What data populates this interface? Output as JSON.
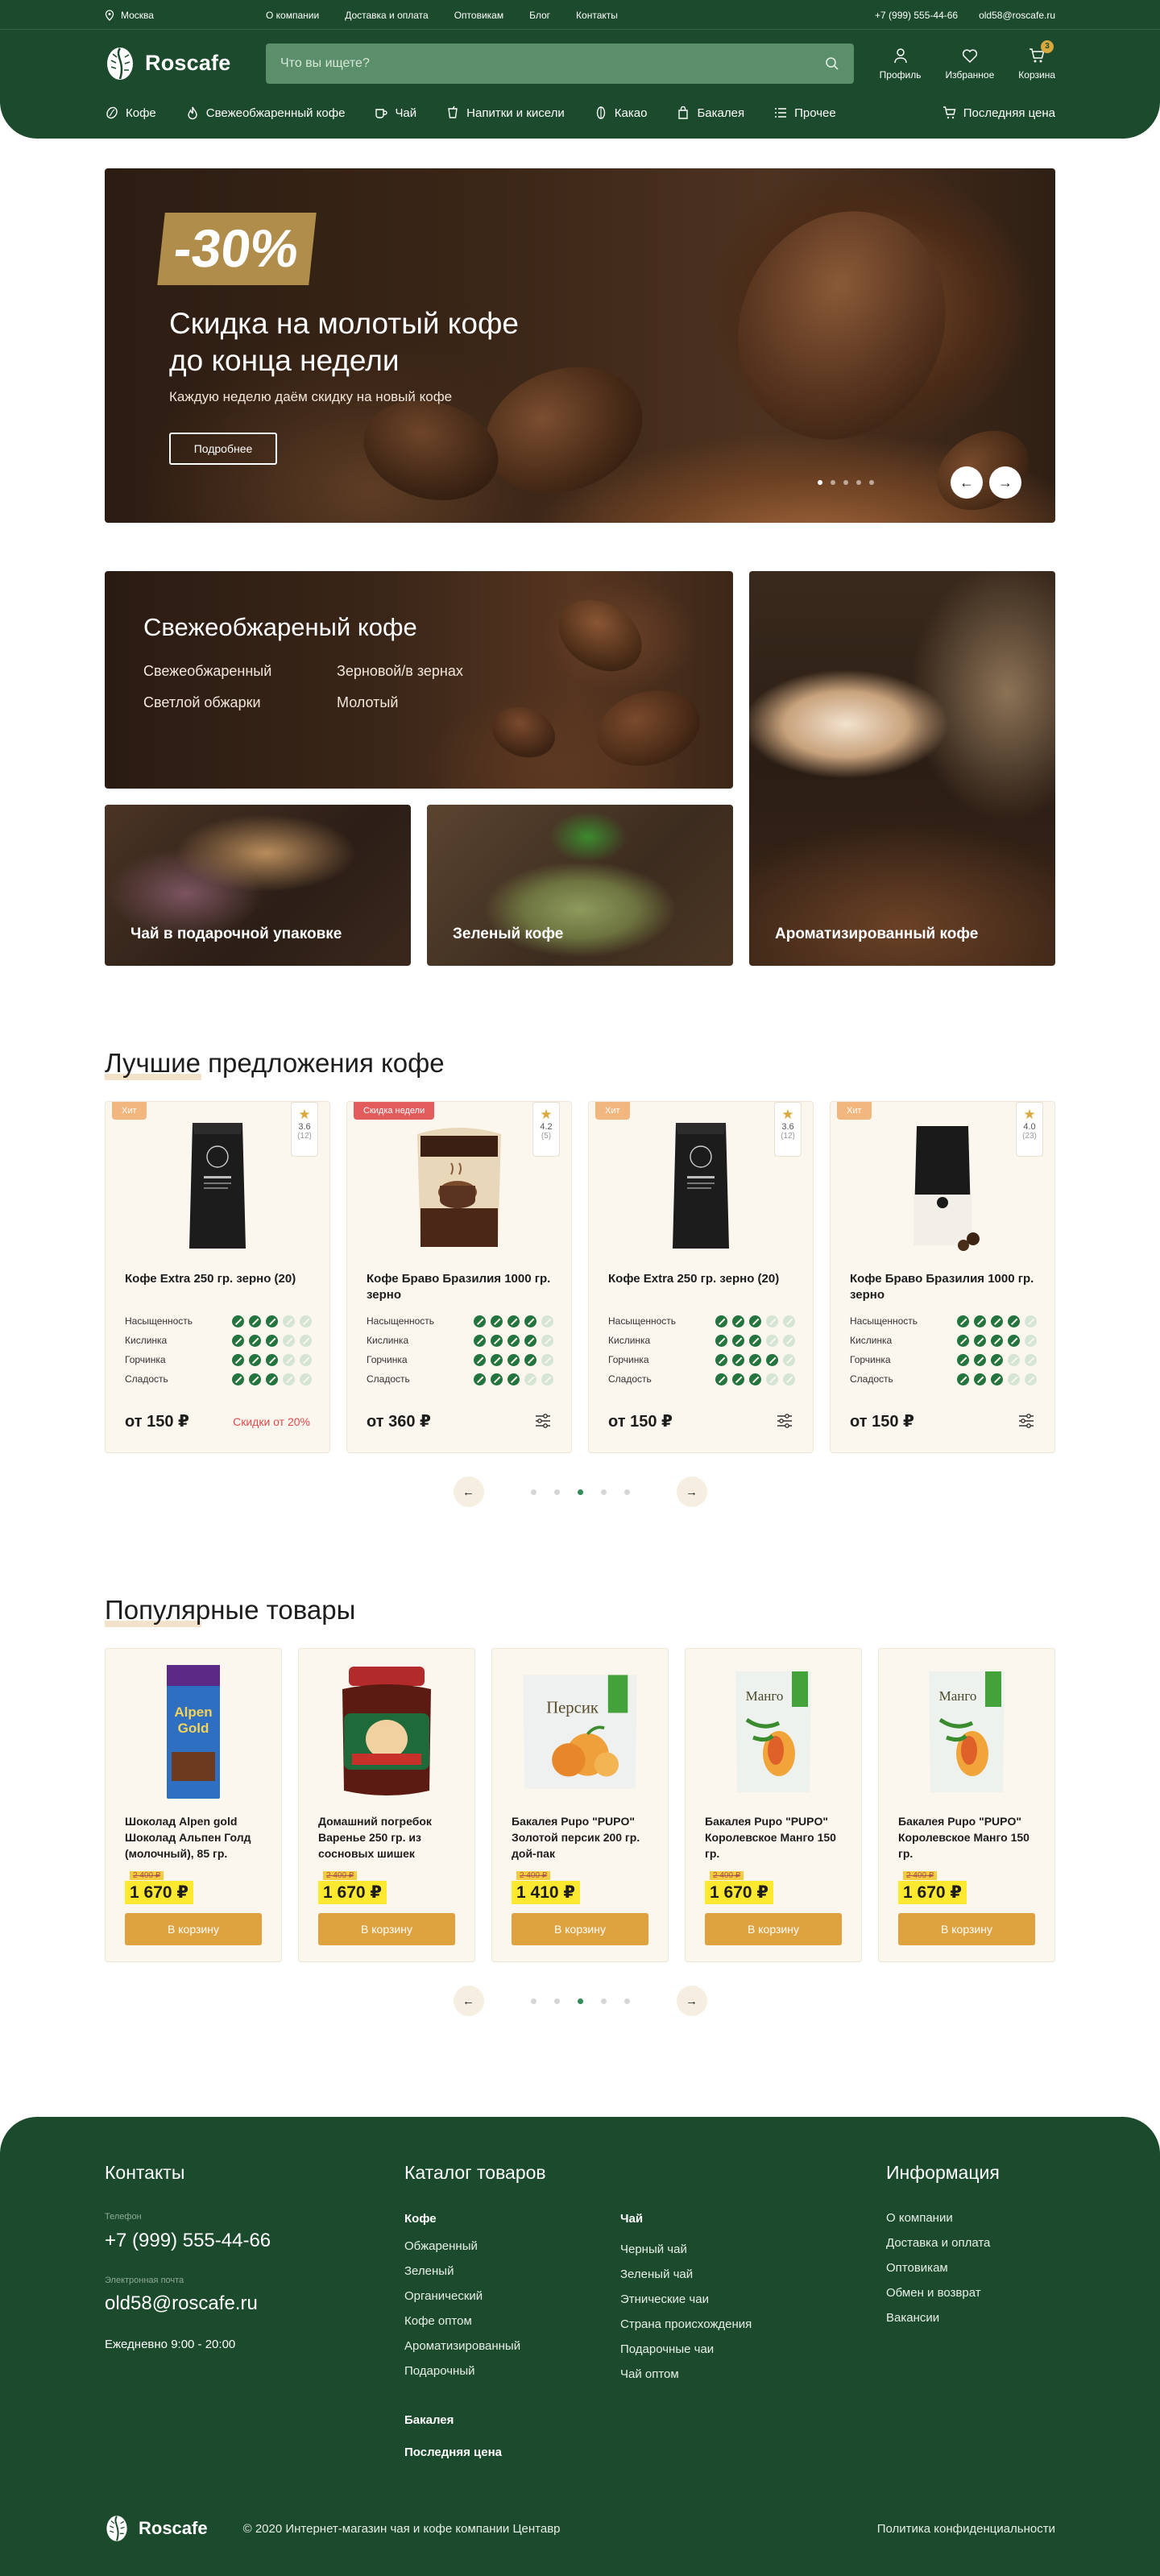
{
  "topbar": {
    "city": "Москва",
    "links": [
      "О компании",
      "Доставка и оплата",
      "Оптовикам",
      "Блог",
      "Контакты"
    ],
    "phone": "+7 (999) 555-44-66",
    "email": "old58@roscafe.ru"
  },
  "header": {
    "brand": "Roscafe",
    "search_placeholder": "Что вы ищете?",
    "profile_label": "Профиль",
    "favorites_label": "Избранное",
    "cart_label": "Корзина",
    "cart_count": "3"
  },
  "catnav": [
    {
      "label": "Кофе",
      "icon": "coffee-bean-icon"
    },
    {
      "label": "Свежеобжаренный кофе",
      "icon": "fire-icon"
    },
    {
      "label": "Чай",
      "icon": "tea-cup-icon"
    },
    {
      "label": "Напитки и кисели",
      "icon": "drink-icon"
    },
    {
      "label": "Какао",
      "icon": "cocoa-icon"
    },
    {
      "label": "Бакалея",
      "icon": "grocery-bag-icon"
    },
    {
      "label": "Прочее",
      "icon": "list-icon"
    }
  ],
  "catnav_last": "Последняя цена",
  "hero": {
    "badge": "-30%",
    "title": "Скидка на молотый кофе до конца недели",
    "subtitle": "Каждую неделю даём скидку на новый кофе",
    "button": "Подробнее",
    "slides": 5,
    "active_slide": 1
  },
  "categories": {
    "main": {
      "title": "Свежеобжареный кофе",
      "links": [
        "Свежеобжаренный",
        "Зерновой/в зернах",
        "Светлой обжарки",
        "Молотый"
      ]
    },
    "tiles": [
      "Ароматизированный кофе",
      "Чай в подарочной упаковке",
      "Зеленый кофе"
    ]
  },
  "best": {
    "title": "Лучшие предложения кофе",
    "prop_names": [
      "Насыщенность",
      "Кислинка",
      "Горчинка",
      "Сладость"
    ],
    "items": [
      {
        "tag": "Хит",
        "tag_type": "hit",
        "rating": "3.6",
        "reviews": "(12)",
        "name": "Кофе Extra 250 гр. зерно (20)",
        "levels": [
          3,
          3,
          3,
          3
        ],
        "price": "от 150 ₽",
        "note": "Скидки от 20%",
        "pack": "black"
      },
      {
        "tag": "Скидка недели",
        "tag_type": "week",
        "rating": "4.2",
        "reviews": "(5)",
        "name": "Кофе Браво Бразилия 1000 гр. зерно",
        "levels": [
          4,
          4,
          4,
          3
        ],
        "price": "от 360 ₽",
        "note": "",
        "pack": "mokka"
      },
      {
        "tag": "Хит",
        "tag_type": "hit",
        "rating": "3.6",
        "reviews": "(12)",
        "name": "Кофе Extra 250 гр. зерно (20)",
        "levels": [
          3,
          3,
          4,
          3
        ],
        "price": "от 150 ₽",
        "note": "",
        "pack": "black"
      },
      {
        "tag": "Хит",
        "tag_type": "hit",
        "rating": "4.0",
        "reviews": "(23)",
        "name": "Кофе Браво Бразилия 1000 гр. зерно",
        "levels": [
          4,
          4,
          3,
          3
        ],
        "price": "от 150 ₽",
        "note": "",
        "pack": "bw"
      }
    ],
    "pages": 5,
    "active_page": 3
  },
  "popular": {
    "title": "Популярные товары",
    "cart_button": "В корзину",
    "items": [
      {
        "name": "Шоколад Alpen gold Шоколад Альпен Голд (молочный), 85 гр.",
        "old": "2 400 ₽",
        "price": "1 670 ₽",
        "img": "alpen"
      },
      {
        "name": "Домашний погребок Варенье 250 гр. из сосновых шишек",
        "old": "2 400 ₽",
        "price": "1 670 ₽",
        "img": "jam"
      },
      {
        "name": "Бакалея Pupo \"PUPO\" Золотой персик 200 гр. дой-пак",
        "old": "2 400 ₽",
        "price": "1 410 ₽",
        "img": "peach"
      },
      {
        "name": "Бакалея Pupo \"PUPO\" Королевское Манго 150 гр.",
        "old": "2 400 ₽",
        "price": "1 670 ₽",
        "img": "mango"
      },
      {
        "name": "Бакалея Pupo \"PUPO\" Королевское Манго 150 гр.",
        "old": "2 400 ₽",
        "price": "1 670 ₽",
        "img": "mango"
      }
    ],
    "pages": 5,
    "active_page": 3
  },
  "footer": {
    "contacts_title": "Контакты",
    "phone_label": "Телефон",
    "phone": "+7 (999) 555-44-66",
    "email_label": "Электронная почта",
    "email": "old58@roscafe.ru",
    "hours": "Ежедневно 9:00 - 20:00",
    "catalog_title": "Каталог товаров",
    "coffee_head": "Кофе",
    "coffee_links": [
      "Обжаренный",
      "Зеленый",
      "Органический",
      "Кофе оптом",
      "Ароматизированный",
      "Подарочный"
    ],
    "grocery_head": "Бакалея",
    "last_price_head": "Последняя цена",
    "tea_head": "Чай",
    "tea_links": [
      "Черный чай",
      "Зеленый чай",
      "Этнические чаи",
      "Страна происхождения",
      "Подарочные чаи",
      "Чай оптом"
    ],
    "info_title": "Информация",
    "info_links": [
      "О компании",
      "Доставка и оплата",
      "Оптовикам",
      "Обмен и возврат",
      "Вакансии"
    ],
    "brand": "Roscafe",
    "copyright": "© 2020 Интернет-магазин чая и кофе компании Центавр",
    "privacy": "Политика конфиденциальности"
  },
  "colors": {
    "brand_green": "#1b4a2c",
    "accent_gold": "#dea23e",
    "price_highlight": "#ffe930",
    "card_bg": "#fbf6ee"
  }
}
